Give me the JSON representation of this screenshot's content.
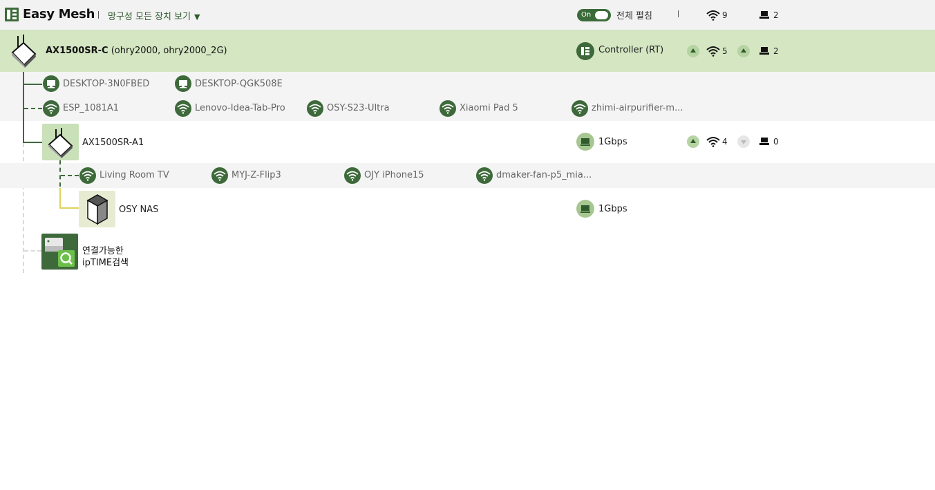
{
  "header": {
    "app_title": "Easy Mesh",
    "view_select": "망구성 모든 장치 보기",
    "toggle_state": "On",
    "expand_all_label": "전체 펼침",
    "wifi_total": "9",
    "wired_total": "2"
  },
  "controller": {
    "model": "AX1500SR-C",
    "ssids": "(ohry2000, ohry2000_2G)",
    "role": "Controller (RT)",
    "wifi_count": "5",
    "wired_count": "2"
  },
  "controller_wired_clients": [
    "DESKTOP-3N0FBED",
    "DESKTOP-QGK508E"
  ],
  "controller_wifi_clients": [
    "ESP_1081A1",
    "Lenovo-Idea-Tab-Pro",
    "OSY-S23-Ultra",
    "Xiaomi Pad 5",
    "zhimi-airpurifier-m..."
  ],
  "agent": {
    "model": "AX1500SR-A1",
    "link_speed": "1Gbps",
    "wifi_count": "4",
    "wired_count": "0"
  },
  "agent_wifi_clients": [
    "Living Room TV",
    "MYJ-Z-Flip3",
    "OJY iPhone15",
    "dmaker-fan-p5_mia..."
  ],
  "nas": {
    "name": "OSY NAS",
    "link_speed": "1Gbps"
  },
  "search": {
    "line1": "연결가능한",
    "line2": "ipTIME검색"
  },
  "colors": {
    "accent": "#3e6a3b",
    "header_row_bg": "#d4e6c2",
    "topbar_bg": "#f2f2f2"
  }
}
